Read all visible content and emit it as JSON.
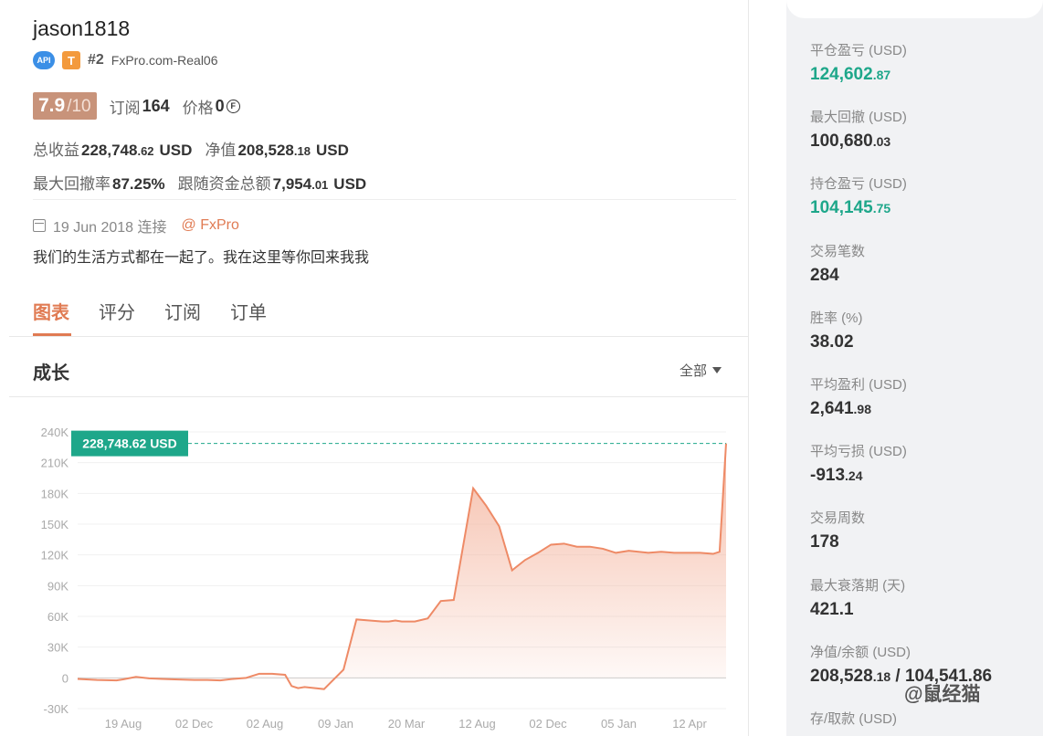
{
  "trader": {
    "name": "jason1818",
    "api_badge": "API",
    "tier_badge": "T",
    "rank": "#2",
    "broker_account": "FxPro.com-Real06",
    "score": "7.9",
    "score_max": "/10",
    "subscriptions_label": "订阅",
    "subscriptions": "164",
    "price_label": "价格",
    "price": "0",
    "price_icon": "coin-icon"
  },
  "stats": {
    "total_profit_label": "总收益",
    "total_profit_int": "228,748",
    "total_profit_dec": ".62",
    "equity_label": "净值",
    "equity_int": "208,528",
    "equity_dec": ".18",
    "currency": "USD",
    "max_drawdown_label": "最大回撤率",
    "max_drawdown": "87.25%",
    "follower_funds_label": "跟随资金总额",
    "follower_funds_int": "7,954",
    "follower_funds_dec": ".01"
  },
  "connection": {
    "icon": "calendar-icon",
    "date": "19 Jun 2018 连接",
    "broker_link": "@ FxPro",
    "bio": "我们的生活方式都在一起了。我在这里等你回来我我"
  },
  "tabs": [
    {
      "label": "图表",
      "active": true
    },
    {
      "label": "评分",
      "active": false
    },
    {
      "label": "订阅",
      "active": false
    },
    {
      "label": "订单",
      "active": false
    }
  ],
  "chart_section": {
    "title": "成长",
    "range_select": "全部"
  },
  "chart_data": {
    "type": "area",
    "title": "",
    "xlabel": "",
    "ylabel": "",
    "ylim": [
      -30000,
      240000
    ],
    "y_ticks": [
      "240K",
      "210K",
      "180K",
      "150K",
      "120K",
      "90K",
      "60K",
      "30K",
      "0",
      "-30K"
    ],
    "x_ticks": [
      "19 Aug",
      "02 Dec",
      "02 Aug",
      "09 Jan",
      "20 Mar",
      "12 Aug",
      "02 Dec",
      "05 Jan",
      "12 Apr"
    ],
    "current_value_label": "228,748.62 USD",
    "current_value": 228748.62,
    "x": [
      0,
      3,
      6,
      7,
      9,
      11,
      13,
      15,
      18,
      20,
      22,
      24,
      26,
      27,
      28,
      30,
      32,
      33,
      34,
      35,
      38,
      41,
      43,
      45,
      47,
      48,
      49,
      50,
      52,
      54,
      56,
      58,
      61,
      63,
      65,
      67,
      69,
      71,
      73,
      75,
      77,
      79,
      81,
      83,
      85,
      88,
      90,
      92,
      94,
      96,
      98,
      99,
      100
    ],
    "values": [
      -1000,
      -2000,
      -2500,
      -1500,
      1000,
      -500,
      -1000,
      -1500,
      -2000,
      -2000,
      -2500,
      -1000,
      0,
      2000,
      4000,
      4000,
      3000,
      -8000,
      -10000,
      -9000,
      -11000,
      8000,
      57000,
      56000,
      55000,
      55000,
      56000,
      55000,
      55000,
      58000,
      75000,
      76000,
      185000,
      168000,
      148000,
      105000,
      115000,
      122000,
      130000,
      131000,
      128000,
      128000,
      126000,
      122000,
      124000,
      122000,
      123000,
      122000,
      122000,
      122000,
      121000,
      123000,
      228748
    ],
    "line_color": "#ee8a66",
    "fill_color": "#f4b6a0",
    "zero_line_color": "#cccccc",
    "label_color": "#1ea78a"
  },
  "sidebar": {
    "metrics": [
      {
        "label": "平仓盈亏 (USD)",
        "int": "124,602",
        "dec": ".87",
        "positive": true
      },
      {
        "label": "最大回撤 (USD)",
        "int": "100,680",
        "dec": ".03",
        "positive": false
      },
      {
        "label": "持仓盈亏 (USD)",
        "int": "104,145",
        "dec": ".75",
        "positive": true
      },
      {
        "label": "交易笔数",
        "int": "284",
        "dec": "",
        "positive": false
      },
      {
        "label": "胜率 (%)",
        "int": "38.02",
        "dec": "",
        "positive": false
      },
      {
        "label": "平均盈利 (USD)",
        "int": "2,641",
        "dec": ".98",
        "positive": false
      },
      {
        "label": "平均亏损 (USD)",
        "int": "-913",
        "dec": ".24",
        "positive": false
      },
      {
        "label": "交易周数",
        "int": "178",
        "dec": "",
        "positive": false
      },
      {
        "label": "最大衰落期 (天)",
        "int": "421.1",
        "dec": "",
        "positive": false
      },
      {
        "label": "净值/余额 (USD)",
        "int": "208,528",
        "dec": ".18",
        "suffix": " / 104,541.86",
        "positive": false
      },
      {
        "label": "存/取款 (USD)",
        "int": "",
        "dec": "",
        "positive": false
      }
    ]
  },
  "watermark": "@鼠经猫"
}
